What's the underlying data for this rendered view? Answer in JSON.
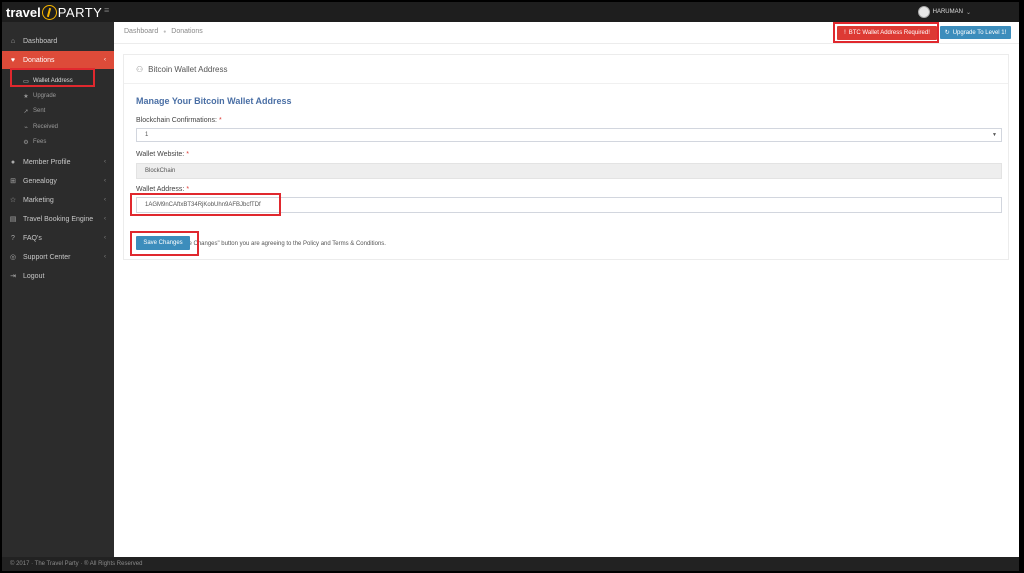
{
  "brand": {
    "travel": "travel",
    "party": "PARTY"
  },
  "user": {
    "name": "HARUMAN"
  },
  "sidebar": {
    "items": [
      {
        "label": "Dashboard",
        "icon": "home-icon"
      },
      {
        "label": "Donations",
        "icon": "heart-icon"
      },
      {
        "label": "Member Profile",
        "icon": "user-icon"
      },
      {
        "label": "Genealogy",
        "icon": "sitemap-icon"
      },
      {
        "label": "Marketing",
        "icon": "star-icon"
      },
      {
        "label": "Travel Booking Engine",
        "icon": "ticket-icon"
      },
      {
        "label": "FAQ's",
        "icon": "question-icon"
      },
      {
        "label": "Support Center",
        "icon": "lifebuoy-icon"
      },
      {
        "label": "Logout",
        "icon": "logout-icon"
      }
    ],
    "donations_sub": [
      {
        "label": "Wallet Address",
        "icon": "card-icon"
      },
      {
        "label": "Upgrade",
        "icon": "star-icon"
      },
      {
        "label": "Sent",
        "icon": "send-icon"
      },
      {
        "label": "Received",
        "icon": "chart-icon"
      },
      {
        "label": "Fees",
        "icon": "gear-icon"
      }
    ]
  },
  "breadcrumb": {
    "home": "Dashboard",
    "current": "Donations"
  },
  "header_buttons": {
    "btc_required": "BTC Wallet Address Required!",
    "upgrade": "Upgrade To Level 1!"
  },
  "panel": {
    "title": "Bitcoin Wallet Address",
    "section_title": "Manage Your Bitcoin Wallet Address",
    "confirmations_label": "Blockchain Confirmations:",
    "confirmations_value": "1",
    "website_label": "Wallet Website:",
    "website_value": "BlockChain",
    "address_label": "Wallet Address:",
    "address_value": "1AGM9nCAftxBT34RjKobUhn9AFBJbcfTDf",
    "required_mark": "*",
    "agreement": "By clicking the \"Save Changes\" button you are agreeing to the Policy and Terms & Conditions.",
    "save_label": "Save Changes"
  },
  "footer": {
    "text": "© 2017 · The Travel Party · ® All Rights Reserved"
  },
  "colors": {
    "accent": "#3c8dbc",
    "danger": "#dd3a34",
    "highlight": "#e0282e",
    "sidebar": "#2c2c2c"
  }
}
